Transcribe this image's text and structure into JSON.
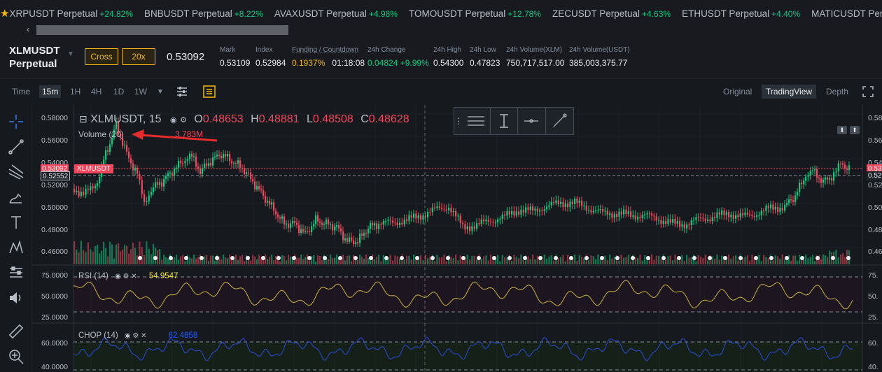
{
  "ticker": {
    "items": [
      {
        "symbol": "XRPUSDT Perpetual",
        "change": "+24.82%"
      },
      {
        "symbol": "BNBUSDT Perpetual",
        "change": "+8.22%"
      },
      {
        "symbol": "AVAXUSDT Perpetual",
        "change": "+4.98%"
      },
      {
        "symbol": "TOMOUSDT Perpetual",
        "change": "+12.78%"
      },
      {
        "symbol": "ZECUSDT Perpetual",
        "change": "+4.63%"
      },
      {
        "symbol": "ETHUSDT Perpetual",
        "change": "+4.40%"
      },
      {
        "symbol": "MATICUSDT Perpetual",
        "change": ""
      }
    ]
  },
  "header": {
    "symbol_line1": "XLMUSDT",
    "symbol_line2": "Perpetual",
    "margin_mode": "Cross",
    "leverage": "20x",
    "last_price": "0.53092",
    "mark_label": "Mark",
    "mark": "0.53109",
    "index_label": "Index",
    "index": "0.52984",
    "funding_label": "Funding / Countdown",
    "funding_rate": "0.1937%",
    "countdown": "01:18:08",
    "change_label": "24h Change",
    "change": "0.04824 +9.99%",
    "high_label": "24h High",
    "high": "0.54300",
    "low_label": "24h Low",
    "low": "0.47823",
    "vol_xlm_label": "24h Volume(XLM)",
    "vol_xlm": "750,717,517.00",
    "vol_usdt_label": "24h Volume(USDT)",
    "vol_usdt": "385,003,375.77"
  },
  "toolbar": {
    "time": "Time",
    "intervals": [
      "15m",
      "1H",
      "4H",
      "1D",
      "1W"
    ],
    "active_interval": "15m",
    "views": [
      "Original",
      "TradingView",
      "Depth"
    ],
    "active_view": "TradingView"
  },
  "chart": {
    "legend_symbol": "XLMUSDT, 15",
    "open_label": "O",
    "open": "0.48653",
    "high_label": "H",
    "high": "0.48881",
    "low_label": "L",
    "low": "0.48508",
    "close_label": "C",
    "close": "0.48628",
    "volume_label": "Volume (20)",
    "volume_value": "3.783M",
    "price_ticks": [
      "0.58000",
      "0.56000",
      "0.54000",
      "0.52000",
      "0.50000",
      "0.48000",
      "0.46000"
    ],
    "right_ticks": [
      "0.58",
      "0.56",
      "0.54",
      "0.52",
      "0.50",
      "0.48",
      "0.46"
    ],
    "last_tag": "0.53092",
    "index_tag": "0.52552",
    "symbol_tag": "XLMUSDT",
    "right_tag_1": "0.53",
    "right_tag_2": "0.52",
    "rsi_label": "RSI (14)",
    "rsi_value": "54.9547",
    "rsi_ticks": [
      "75.0000",
      "50.0000",
      "25.0000"
    ],
    "rsi_right_ticks": [
      "75.",
      "50.",
      "25."
    ],
    "chop_label": "CHOP (14)",
    "chop_value": "62.4858",
    "chop_ticks": [
      "60.0000",
      "40.0000"
    ],
    "chop_right_ticks": [
      "60.",
      "40."
    ],
    "colors": {
      "up": "#0ecb81",
      "down": "#f6465d",
      "rsi": "#c9b53a",
      "chop": "#2b4cd8",
      "accent": "#f0b90b"
    }
  }
}
